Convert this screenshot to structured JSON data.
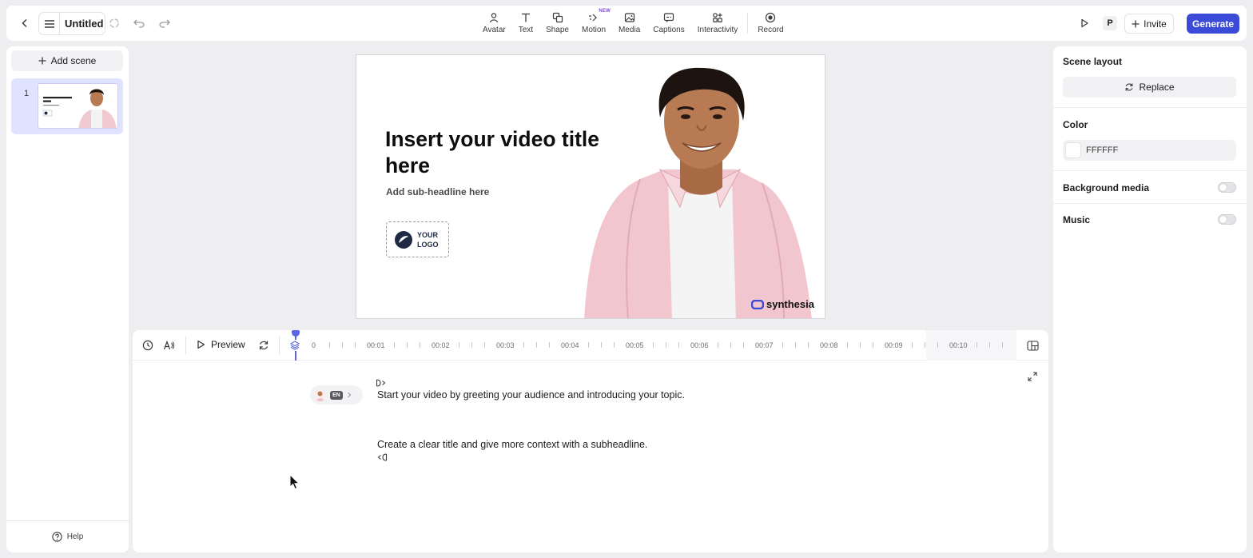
{
  "topbar": {
    "doc_title": "Untitled",
    "tools": [
      {
        "label": "Avatar",
        "icon": "avatar-icon"
      },
      {
        "label": "Text",
        "icon": "text-icon"
      },
      {
        "label": "Shape",
        "icon": "shape-icon"
      },
      {
        "label": "Motion",
        "icon": "motion-icon",
        "badge": "NEW"
      },
      {
        "label": "Media",
        "icon": "media-icon"
      },
      {
        "label": "Captions",
        "icon": "captions-icon"
      },
      {
        "label": "Interactivity",
        "icon": "interactivity-icon"
      },
      {
        "label": "Record",
        "icon": "record-icon"
      }
    ],
    "user_initial": "P",
    "invite_label": "Invite",
    "generate_label": "Generate"
  },
  "left_panel": {
    "add_scene_label": "Add scene",
    "scenes": [
      {
        "number": "1"
      }
    ],
    "help_label": "Help"
  },
  "canvas": {
    "title": "Insert your video title here",
    "subtitle": "Add sub-headline here",
    "logo_line1": "YOUR",
    "logo_line2": "LOGO",
    "brand": "synthesia"
  },
  "timeline": {
    "preview_label": "Preview",
    "ruler": [
      "0",
      "00:01",
      "00:02",
      "00:03",
      "00:04",
      "00:05",
      "00:06",
      "00:07",
      "00:08",
      "00:09",
      "00:10"
    ],
    "avatar_language": "EN",
    "script_line1": "Start your video by greeting your audience and introducing your topic.",
    "script_line2": "Create a clear title and give more context with a subheadline."
  },
  "right_panel": {
    "scene_layout_label": "Scene layout",
    "replace_label": "Replace",
    "color_label": "Color",
    "color_value": "FFFFFF",
    "background_media_label": "Background media",
    "music_label": "Music"
  },
  "colors": {
    "accent": "#3b4bd8",
    "scene_selected": "#dfe3ff",
    "new_badge": "#7a4bd6"
  }
}
